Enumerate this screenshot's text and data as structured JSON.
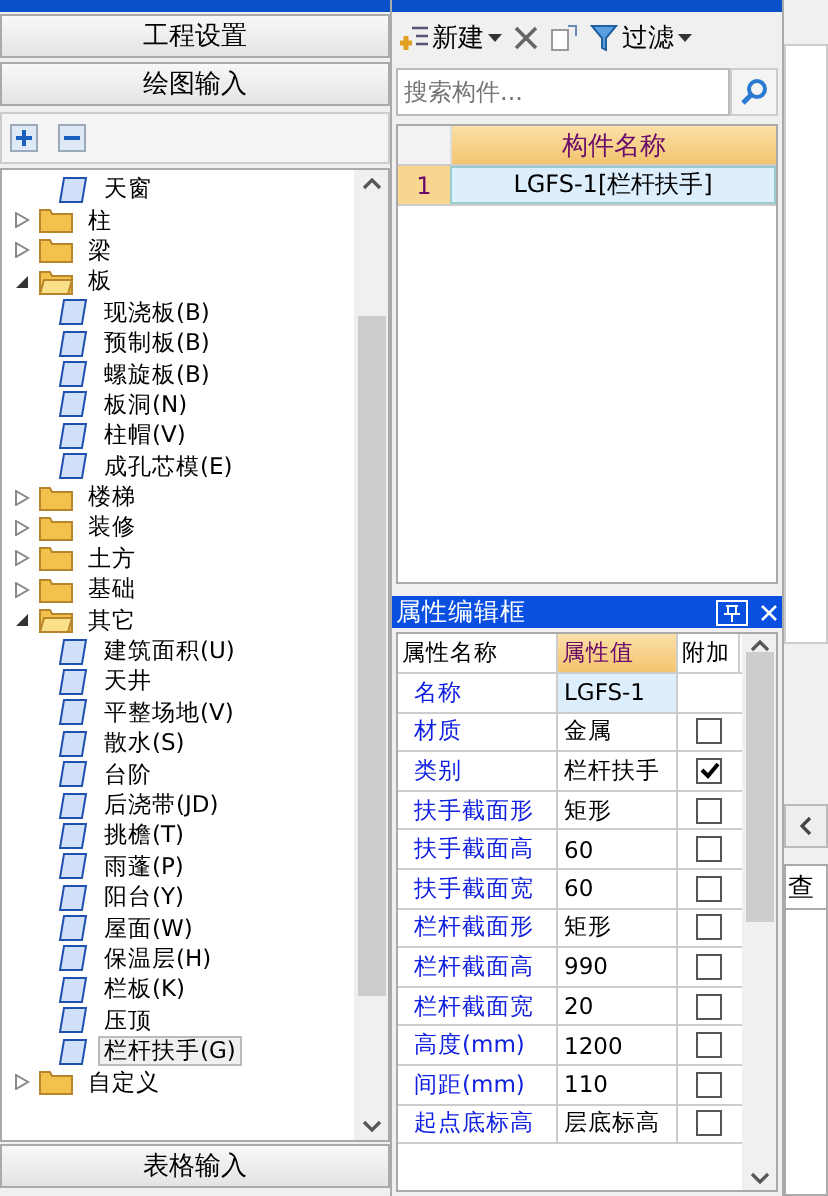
{
  "navigator": {
    "buttons": [
      {
        "label": "工程设置"
      },
      {
        "label": "绘图输入"
      }
    ],
    "tree": [
      {
        "label": "天窗",
        "kind": "leaf",
        "selected": false
      },
      {
        "label": "柱",
        "kind": "folder",
        "expanded": false
      },
      {
        "label": "梁",
        "kind": "folder",
        "expanded": false
      },
      {
        "label": "板",
        "kind": "folder",
        "expanded": true,
        "children": [
          {
            "label": "现浇板(B)",
            "kind": "leaf",
            "selected": false
          },
          {
            "label": "预制板(B)",
            "kind": "leaf",
            "selected": false
          },
          {
            "label": "螺旋板(B)",
            "kind": "leaf",
            "selected": false
          },
          {
            "label": "板洞(N)",
            "kind": "leaf",
            "selected": false
          },
          {
            "label": "柱帽(V)",
            "kind": "leaf",
            "selected": false
          },
          {
            "label": "成孔芯模(E)",
            "kind": "leaf",
            "selected": false
          }
        ]
      },
      {
        "label": "楼梯",
        "kind": "folder",
        "expanded": false
      },
      {
        "label": "装修",
        "kind": "folder",
        "expanded": false
      },
      {
        "label": "土方",
        "kind": "folder",
        "expanded": false
      },
      {
        "label": "基础",
        "kind": "folder",
        "expanded": false
      },
      {
        "label": "其它",
        "kind": "folder",
        "expanded": true,
        "children": [
          {
            "label": "建筑面积(U)",
            "kind": "leaf",
            "selected": false
          },
          {
            "label": "天井",
            "kind": "leaf",
            "selected": false
          },
          {
            "label": "平整场地(V)",
            "kind": "leaf",
            "selected": false
          },
          {
            "label": "散水(S)",
            "kind": "leaf",
            "selected": false
          },
          {
            "label": "台阶",
            "kind": "leaf",
            "selected": false
          },
          {
            "label": "后浇带(JD)",
            "kind": "leaf",
            "selected": false
          },
          {
            "label": "挑檐(T)",
            "kind": "leaf",
            "selected": false
          },
          {
            "label": "雨蓬(P)",
            "kind": "leaf",
            "selected": false
          },
          {
            "label": "阳台(Y)",
            "kind": "leaf",
            "selected": false
          },
          {
            "label": "屋面(W)",
            "kind": "leaf",
            "selected": false
          },
          {
            "label": "保温层(H)",
            "kind": "leaf",
            "selected": false
          },
          {
            "label": "栏板(K)",
            "kind": "leaf",
            "selected": false
          },
          {
            "label": "压顶",
            "kind": "leaf",
            "selected": false
          },
          {
            "label": "栏杆扶手(G)",
            "kind": "leaf",
            "selected": true
          }
        ]
      },
      {
        "label": "自定义",
        "kind": "folder",
        "expanded": false
      }
    ],
    "bottom_button": "表格输入"
  },
  "component_list": {
    "new_button": "新建",
    "filter_button": "过滤",
    "search": {
      "placeholder": "搜索构件..."
    },
    "table": {
      "columns": [
        "构件名称"
      ],
      "rows": [
        {
          "index": "1",
          "name": "LGFS-1[栏杆扶手]",
          "selected": true
        }
      ]
    }
  },
  "properties": {
    "title": "属性编辑框",
    "columns": [
      "属性名称",
      "属性值",
      "附加"
    ],
    "rows": [
      {
        "name": "名称",
        "value": "LGFS-1",
        "kind": "plain"
      },
      {
        "name": "材质",
        "value": "金属",
        "kind": "check",
        "checked": false
      },
      {
        "name": "类别",
        "value": "栏杆扶手",
        "kind": "check",
        "checked": true
      },
      {
        "name": "扶手截面形",
        "value": "矩形",
        "kind": "check",
        "checked": false
      },
      {
        "name": "扶手截面高",
        "value": "60",
        "kind": "check",
        "checked": false
      },
      {
        "name": "扶手截面宽",
        "value": "60",
        "kind": "check",
        "checked": false
      },
      {
        "name": "栏杆截面形",
        "value": "矩形",
        "kind": "check",
        "checked": false
      },
      {
        "name": "栏杆截面高",
        "value": "990",
        "kind": "check",
        "checked": false
      },
      {
        "name": "栏杆截面宽",
        "value": "20",
        "kind": "check",
        "checked": false
      },
      {
        "name": "高度(mm)",
        "value": "1200",
        "kind": "check",
        "checked": false
      },
      {
        "name": "间距(mm)",
        "value": "110",
        "kind": "check",
        "checked": false
      },
      {
        "name": "起点底标高",
        "value": "层底标高",
        "kind": "check",
        "checked": false
      }
    ]
  },
  "side_strip": {
    "tab": "查"
  }
}
